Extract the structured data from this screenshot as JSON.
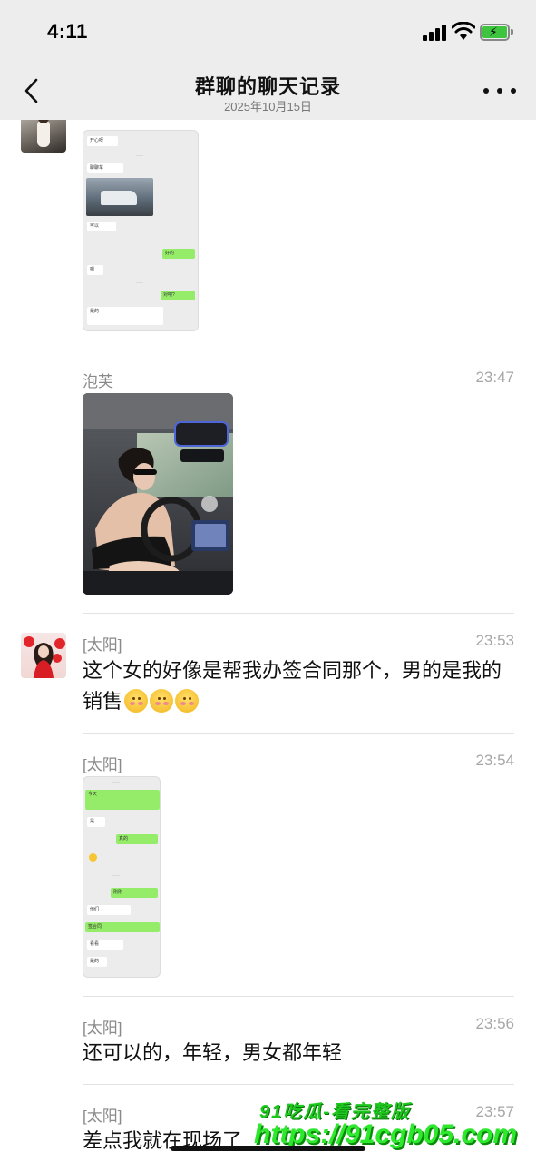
{
  "status": {
    "time": "4:11"
  },
  "nav": {
    "title": "群聊的聊天记录",
    "subtitle": "2025年10月15日"
  },
  "messages": [
    {
      "sender": "泡芙",
      "time": "23:47",
      "type": "image",
      "image": "car-selfie-photo"
    },
    {
      "sender": "[太阳]",
      "time": "23:53",
      "type": "text",
      "text": "这个女的好像是帮我办签合同那个，男的是我的销售",
      "emojis": 3
    },
    {
      "sender": "[太阳]",
      "time": "23:54",
      "type": "image",
      "image": "chat-screenshot-2"
    },
    {
      "sender": "[太阳]",
      "time": "23:56",
      "type": "text",
      "text": "还可以的，年轻，男女都年轻"
    },
    {
      "sender": "[太阳]",
      "time": "23:57",
      "type": "text",
      "text": "差点我就在现场了"
    }
  ],
  "watermark": {
    "line1": "91吃瓜-看完整版",
    "line2": "https://91cgb05.com"
  },
  "colors": {
    "nav_bg": "#ededed",
    "bubble_green": "#95ec69",
    "watermark": "#2ee82e"
  }
}
